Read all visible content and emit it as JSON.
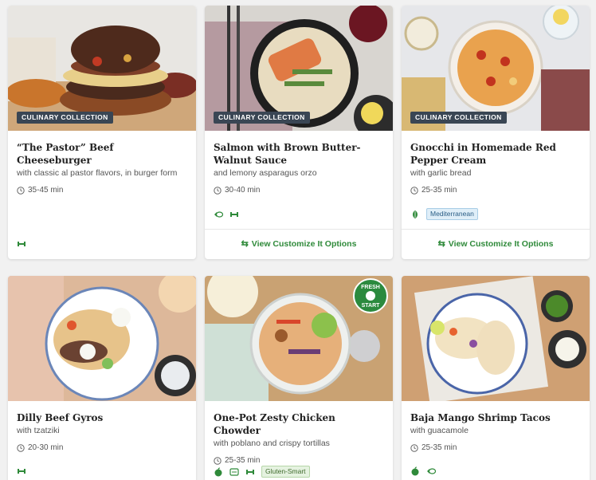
{
  "cards": [
    {
      "badge": "CULINARY COLLECTION",
      "title": "“The Pastor” Beef Cheeseburger",
      "subtitle": "with classic al pastor flavors, in burger form",
      "time": "35-45 min",
      "icons": [
        "protein-icon"
      ]
    },
    {
      "badge": "CULINARY COLLECTION",
      "title": "Salmon with Brown Butter-Walnut Sauce",
      "subtitle": "and lemony asparagus orzo",
      "time": "30-40 min",
      "icons": [
        "pescatarian-icon",
        "protein-icon"
      ],
      "customize": "View Customize It Options"
    },
    {
      "badge": "CULINARY COLLECTION",
      "title": "Gnocchi in Homemade Red Pepper Cream",
      "subtitle": "with garlic bread",
      "time": "25-35 min",
      "icons": [
        "vegetarian-icon"
      ],
      "tag": "Mediterranean",
      "customize": "View Customize It Options"
    },
    {
      "title": "Dilly Beef Gyros",
      "subtitle": "with tzatziki",
      "time": "20-30 min",
      "icons": [
        "protein-icon"
      ]
    },
    {
      "title": "One-Pot Zesty Chicken Chowder",
      "subtitle": "with poblano and crispy tortillas",
      "time": "25-35 min",
      "icons": [
        "apple-icon",
        "calorie-icon",
        "protein-icon"
      ],
      "tag": "Gluten-Smart",
      "fresh_badge_top": "FRESH",
      "fresh_badge_bottom": "START"
    },
    {
      "title": "Baja Mango Shrimp Tacos",
      "subtitle": "with guacamole",
      "time": "25-35 min",
      "icons": [
        "apple-icon",
        "pescatarian-icon"
      ]
    }
  ],
  "colors": {
    "badge_bg": "#3a4654",
    "accent_green": "#2f8a3a",
    "background": "#f1f1f1"
  }
}
